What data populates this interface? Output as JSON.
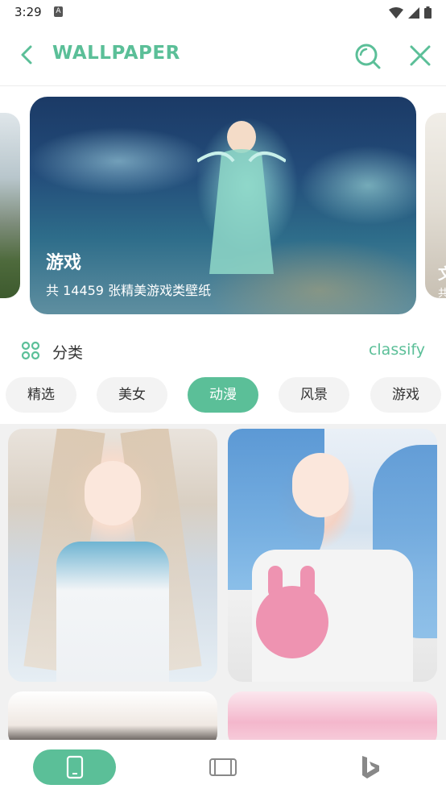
{
  "status_bar": {
    "time": "3:29",
    "badge": "A"
  },
  "app_bar": {
    "title": "WALLPAPER",
    "back_icon": "chevron-left-icon",
    "search_icon": "search-icon",
    "close_icon": "close-icon"
  },
  "banner": {
    "main": {
      "title": "游戏",
      "subtitle": "共 14459 张精美游戏类壁纸"
    },
    "next": {
      "title": "文",
      "subtitle": "共"
    }
  },
  "section": {
    "label": "分类",
    "link": "classify",
    "icon": "grid-icon"
  },
  "chips": [
    {
      "label": "精选",
      "active": false
    },
    {
      "label": "美女",
      "active": false
    },
    {
      "label": "动漫",
      "active": true
    },
    {
      "label": "风景",
      "active": false
    },
    {
      "label": "游戏",
      "active": false
    }
  ],
  "bottom_nav": [
    {
      "icon": "phone-icon",
      "active": true
    },
    {
      "icon": "tablet-icon",
      "active": false
    },
    {
      "icon": "bing-icon",
      "active": false
    }
  ],
  "colors": {
    "accent": "#5bbf98",
    "chip_bg": "#f3f3f3",
    "text": "#333333"
  }
}
